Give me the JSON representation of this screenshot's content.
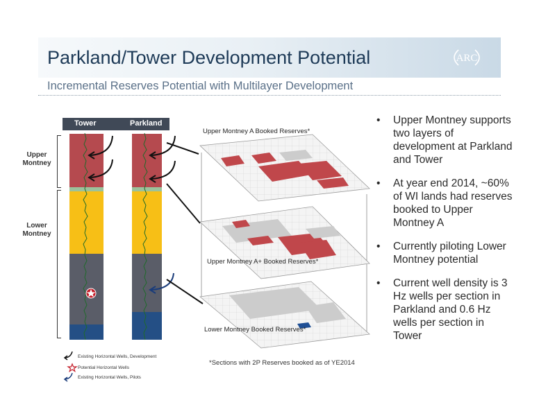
{
  "title": "Parkland/Tower Development Potential",
  "subtitle": "Incremental Reserves Potential with Multilayer Development",
  "logo_text": "ARC",
  "log_panel": {
    "columns": [
      "Tower",
      "Parkland"
    ],
    "zones": {
      "upper": "Upper Montney",
      "lower": "Lower Montney"
    },
    "legend": [
      "Existing Horizontal Wells, Development",
      "Potential Horizontal Wells",
      "Existing Horizontal Wells, Pilots"
    ]
  },
  "maps": {
    "upper_a": "Upper Montney A Booked Reserves*",
    "upper_a_plus": "Upper Montney A+ Booked Reserves*",
    "lower": "Lower Montney Booked Reserves*"
  },
  "footnote": "*Sections with 2P Reserves booked as of YE2014",
  "bullets": [
    "Upper Montney supports two layers of development at Parkland and Tower",
    "At year end 2014, ~60% of WI lands had reserves booked to Upper Montney A",
    "Currently piloting Lower Montney potential",
    "Current well density is 3 Hz wells per section in Parkland and 0.6 Hz wells per section in Tower"
  ],
  "colors": {
    "title": "#1d3a57",
    "red_zone": "#b54a4f",
    "yellow_zone": "#f7bf16",
    "grey_zone": "#5a5d68",
    "blue_zone": "#244f85",
    "reserve_red": "#c0474b",
    "reserve_blue": "#1f4f95",
    "log_trace": "#1f6b2a"
  }
}
